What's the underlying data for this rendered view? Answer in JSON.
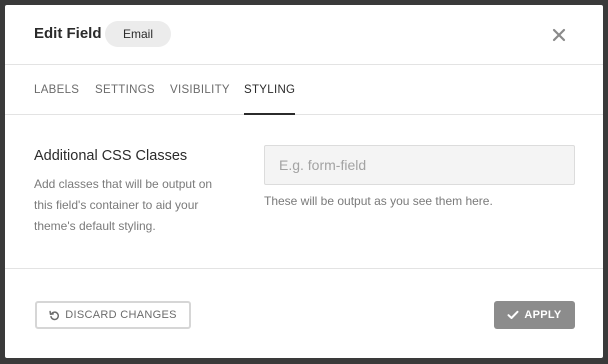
{
  "header": {
    "title": "Edit Field",
    "badge": "Email",
    "close_icon": "close-icon"
  },
  "tabs": [
    {
      "label": "LABELS",
      "active": false
    },
    {
      "label": "SETTINGS",
      "active": false
    },
    {
      "label": "VISIBILITY",
      "active": false
    },
    {
      "label": "STYLING",
      "active": true
    }
  ],
  "styling": {
    "section_title": "Additional CSS Classes",
    "section_description": "Add classes that will be output on this field's container to aid your theme's default styling.",
    "input_placeholder": "E.g. form-field",
    "input_value": "",
    "input_help": "These will be output as you see them here."
  },
  "footer": {
    "discard_label": "DISCARD CHANGES",
    "discard_icon": "undo-icon",
    "apply_label": "APPLY",
    "apply_icon": "check-icon"
  },
  "colors": {
    "overlay": "#3a3a3a",
    "text_primary": "#2b2b2b",
    "text_muted": "#7a7a7a",
    "apply_button": "#8c8c8c"
  }
}
